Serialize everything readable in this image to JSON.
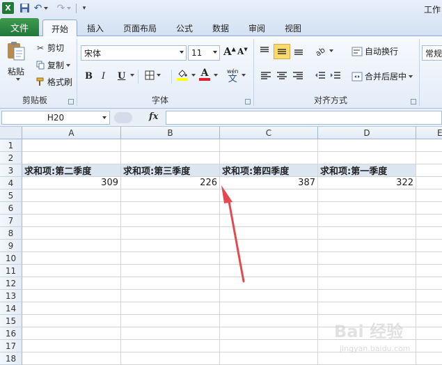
{
  "quick_access": {
    "logo_text": "X",
    "title_fragment": "工作"
  },
  "ribbon_tabs": [
    {
      "label": "文件"
    },
    {
      "label": "开始"
    },
    {
      "label": "插入"
    },
    {
      "label": "页面布局"
    },
    {
      "label": "公式"
    },
    {
      "label": "数据"
    },
    {
      "label": "审阅"
    },
    {
      "label": "视图"
    }
  ],
  "clipboard": {
    "paste": "粘贴",
    "cut": "剪切",
    "copy": "复制",
    "format_painter": "格式刷",
    "group_label": "剪贴板"
  },
  "font": {
    "name": "宋体",
    "size": "11",
    "bold": "B",
    "italic": "I",
    "underline": "U",
    "grow": "A",
    "shrink": "A",
    "color_letter": "A",
    "phonetic": "wén",
    "phonetic_char": "文",
    "group_label": "字体",
    "highlight_color": "#ffff00",
    "font_color": "#e0202a"
  },
  "alignment": {
    "wrap_text": "自动换行",
    "merge_center": "合并后居中",
    "group_label": "对齐方式"
  },
  "number": {
    "format": "常规"
  },
  "formula_bar": {
    "name_box": "H20",
    "fx": "fx",
    "formula": ""
  },
  "columns": [
    "A",
    "B",
    "C",
    "D",
    "E"
  ],
  "rows": [
    "1",
    "2",
    "3",
    "4",
    "5",
    "6",
    "7",
    "8",
    "9",
    "10",
    "11",
    "12",
    "13",
    "14",
    "15",
    "16",
    "17",
    "18"
  ],
  "pivot": {
    "headers": [
      "求和项:第二季度",
      "求和项:第三季度",
      "求和项:第四季度",
      "求和项:第一季度"
    ],
    "values": [
      "309",
      "226",
      "387",
      "322"
    ]
  },
  "watermark": {
    "text": "Bai 经验",
    "sub": "jingyan.baidu.com"
  }
}
